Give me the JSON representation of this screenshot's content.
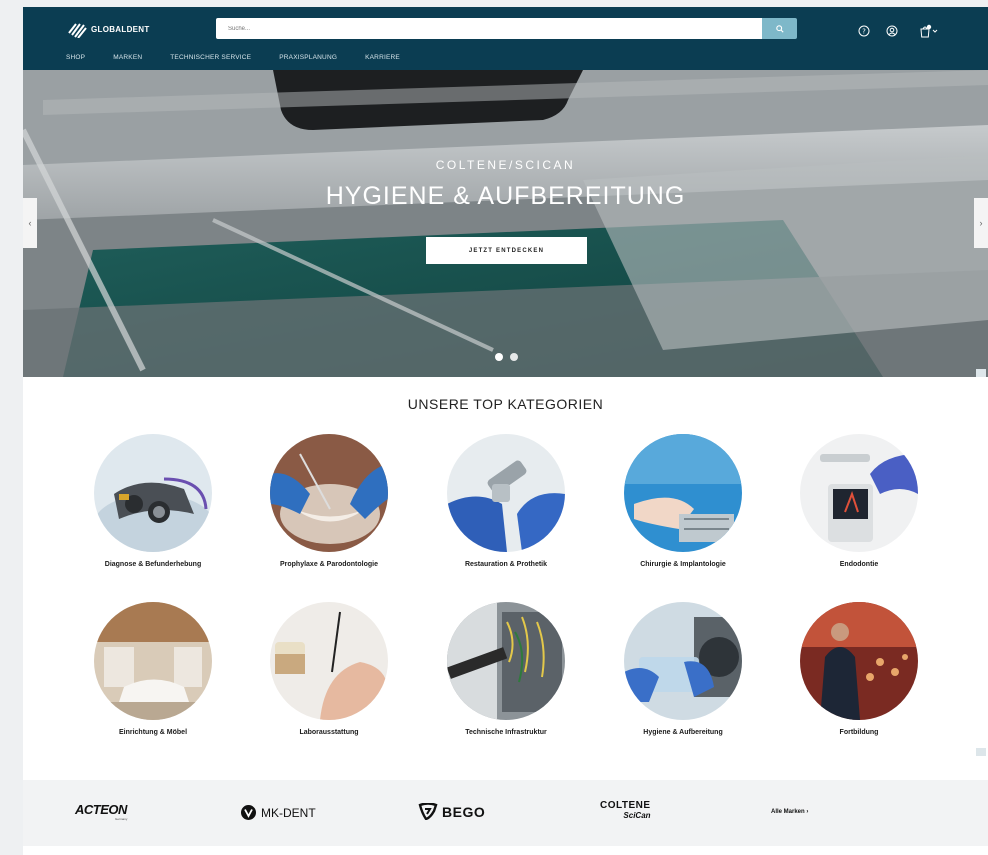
{
  "header": {
    "logo_text": "GLOBALDENT",
    "search": {
      "placeholder": "Suche..."
    },
    "icons": [
      "help-icon",
      "user-icon",
      "cart-icon"
    ],
    "nav": [
      "SHOP",
      "MARKEN",
      "TECHNISCHER SERVICE",
      "PRAXISPLANUNG",
      "KARRIERE"
    ]
  },
  "hero": {
    "subtitle": "COLTENE/SCICAN",
    "title": "HYGIENE & AUFBEREITUNG",
    "cta": "JETZT ENTDECKEN",
    "prev_arrow": "‹",
    "next_arrow": "›",
    "slides_total": 2,
    "slide_active": 1
  },
  "categories": {
    "title": "UNSERE TOP KATEGORIEN",
    "items": [
      "Diagnose & Befunderhebung",
      "Prophylaxe & Parodontologie",
      "Restauration & Prothetik",
      "Chirurgie & Implantologie",
      "Endodontie",
      "Einrichtung & Möbel",
      "Laborausstattung",
      "Technische Infrastruktur",
      "Hygiene & Aufbereitung",
      "Fortbildung"
    ]
  },
  "brands": {
    "items": [
      {
        "name": "ACTEON",
        "sub": "Germany"
      },
      {
        "name": "MK-DENT"
      },
      {
        "name": "BEGO"
      },
      {
        "name": "COLTENE",
        "sub": "SciCan"
      }
    ],
    "all_link": "Alle Marken ›"
  },
  "colors": {
    "header_bg": "#0b3d52",
    "search_button": "#7eb8c9",
    "brand_strip_bg": "#f2f3f4"
  }
}
